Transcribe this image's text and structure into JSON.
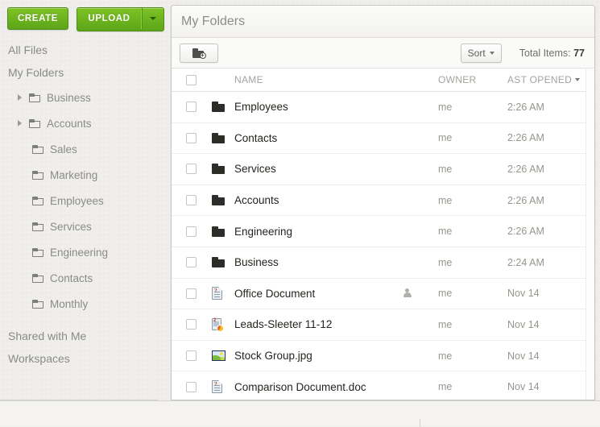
{
  "sidebar": {
    "create_label": "CREATE",
    "upload_label": "UPLOAD",
    "upload_dropdown_icon": "chevron-down-icon",
    "top_links": [
      {
        "label": "All Files"
      },
      {
        "label": "My Folders"
      }
    ],
    "tree": [
      {
        "label": "Business",
        "level": 1,
        "expandable": true,
        "icon": "folder-icon"
      },
      {
        "label": "Accounts",
        "level": 1,
        "expandable": true,
        "icon": "folder-icon"
      },
      {
        "label": "Sales",
        "level": 2,
        "expandable": false,
        "icon": "folder-icon"
      },
      {
        "label": "Marketing",
        "level": 2,
        "expandable": false,
        "icon": "folder-icon"
      },
      {
        "label": "Employees",
        "level": 2,
        "expandable": false,
        "icon": "folder-icon"
      },
      {
        "label": "Services",
        "level": 2,
        "expandable": false,
        "icon": "folder-icon"
      },
      {
        "label": "Engineering",
        "level": 2,
        "expandable": false,
        "icon": "folder-icon"
      },
      {
        "label": "Contacts",
        "level": 2,
        "expandable": false,
        "icon": "folder-icon"
      },
      {
        "label": "Monthly",
        "level": 2,
        "expandable": false,
        "icon": "folder-icon"
      }
    ],
    "bottom_links": [
      {
        "label": "Shared with Me"
      },
      {
        "label": "Workspaces"
      }
    ],
    "toolbar_icons": [
      {
        "name": "chat-settings-icon"
      },
      {
        "name": "bell-icon"
      },
      {
        "name": "speech-bubble-icon"
      },
      {
        "name": "people-icon"
      },
      {
        "name": "person-icon"
      }
    ]
  },
  "panel": {
    "title": "My Folders",
    "toolbar": {
      "new_folder_icon": "new-folder-icon",
      "new_folder_plus": "+",
      "sort_label": "Sort",
      "sort_caret_icon": "chevron-down-icon",
      "total_items_label": "Total Items:",
      "total_items_count": "77"
    },
    "columns": {
      "name": "NAME",
      "owner": "OWNER",
      "last_opened": "AST OPENED",
      "last_opened_caret_icon": "chevron-down-icon"
    },
    "rows": [
      {
        "name": "Employees",
        "icon": "folder-icon",
        "shared": false,
        "owner": "me",
        "date": "2:26 AM"
      },
      {
        "name": "Contacts",
        "icon": "folder-icon",
        "shared": false,
        "owner": "me",
        "date": "2:26 AM"
      },
      {
        "name": "Services",
        "icon": "folder-icon",
        "shared": false,
        "owner": "me",
        "date": "2:26 AM"
      },
      {
        "name": "Accounts",
        "icon": "folder-icon",
        "shared": false,
        "owner": "me",
        "date": "2:26 AM"
      },
      {
        "name": "Engineering",
        "icon": "folder-icon",
        "shared": false,
        "owner": "me",
        "date": "2:26 AM"
      },
      {
        "name": "Business",
        "icon": "folder-icon",
        "shared": false,
        "owner": "me",
        "date": "2:24 AM"
      },
      {
        "name": "Office Document",
        "icon": "document-icon",
        "shared": true,
        "owner": "me",
        "date": "Nov 14"
      },
      {
        "name": "Leads-Sleeter 11-12",
        "icon": "spreadsheet-icon",
        "shared": false,
        "owner": "me",
        "date": "Nov 14"
      },
      {
        "name": "Stock Group.jpg",
        "icon": "image-icon",
        "shared": false,
        "owner": "me",
        "date": "Nov 14"
      },
      {
        "name": "Comparison Document.doc",
        "icon": "document-icon",
        "shared": false,
        "owner": "me",
        "date": "Nov 14"
      }
    ]
  },
  "colors": {
    "accent_green": "#6eb51f",
    "accent_green_dark": "#4d8f14",
    "panel_background": "#ffffff",
    "app_background": "#efeeec",
    "text_primary": "#24241f",
    "text_muted": "#96968f"
  }
}
